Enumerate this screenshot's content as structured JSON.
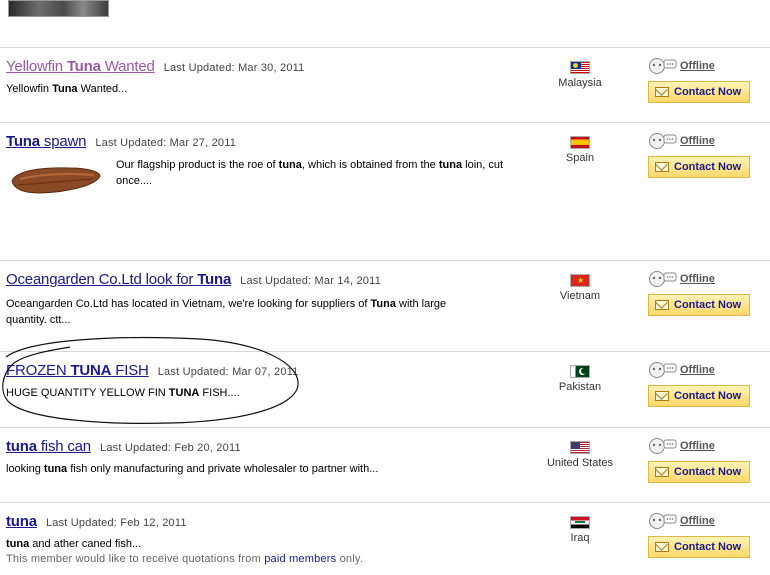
{
  "listings": [
    {
      "title_pre": "Yellowfin ",
      "title_bold": "Tuna",
      "title_post": " Wanted",
      "updated": "Last Updated: Mar 30, 2011",
      "desc_pre": "Yellowfin ",
      "desc_bold": "Tuna",
      "desc_post": " Wanted...",
      "country": "Malaysia",
      "offline": "Offline",
      "contact": "Contact Now"
    },
    {
      "title_pre": "",
      "title_bold": "Tuna",
      "title_post": " spawn",
      "updated": "Last Updated: Mar 27, 2011",
      "desc_pre": "Our flagship product is the roe of ",
      "desc_bold": "tuna",
      "desc_mid": ", which is obtained from the ",
      "desc_bold2": "tuna",
      "desc_post": " loin, cut once....",
      "country": "Spain",
      "offline": "Offline",
      "contact": "Contact Now"
    },
    {
      "title_pre": "Oceangarden Co.Ltd look for ",
      "title_bold": "Tuna",
      "title_post": "",
      "updated": "Last Updated: Mar 14, 2011",
      "desc_pre": "Oceangarden Co.Ltd has located in Vietnam, we're looking for suppliers of ",
      "desc_bold": "Tuna",
      "desc_post": " with large",
      "desc_line2": "quantity. ctt...",
      "country": "Vietnam",
      "offline": "Offline",
      "contact": "Contact Now"
    },
    {
      "title_pre": "FROZEN ",
      "title_bold": "TUNA",
      "title_post": " FISH",
      "updated": "Last Updated: Mar 07, 2011",
      "desc_pre": "HUGE QUANTITY YELLOW FIN ",
      "desc_bold": "TUNA",
      "desc_post": " FISH....",
      "country": "Pakistan",
      "offline": "Offline",
      "contact": "Contact Now"
    },
    {
      "title_pre": "",
      "title_bold": "tuna",
      "title_post": " fish can",
      "updated": "Last Updated: Feb 20, 2011",
      "desc_pre": "looking ",
      "desc_bold": "tuna",
      "desc_post": " fish only manufacturing and private wholesaler to partner with...",
      "country": "United States",
      "offline": "Offline",
      "contact": "Contact Now"
    },
    {
      "title_pre": "",
      "title_bold": "tuna",
      "title_post": "",
      "updated": "Last Updated: Feb 12, 2011",
      "desc_pre": "",
      "desc_bold": "tuna",
      "desc_post": " and ather caned fish...",
      "note_pre": "This member would like to receive quotations from ",
      "note_link": "paid members",
      "note_post": " only.",
      "country": "Iraq",
      "offline": "Offline",
      "contact": "Contact Now"
    }
  ],
  "colors": {
    "link": "#1a1a8c",
    "visited": "#9b59a6",
    "button_bg": "#ffd86a",
    "button_border": "#e0b648",
    "divider": "#d8d8d8"
  },
  "icons": {
    "chat": "chat-bubble-icon",
    "mail": "envelope-icon"
  }
}
